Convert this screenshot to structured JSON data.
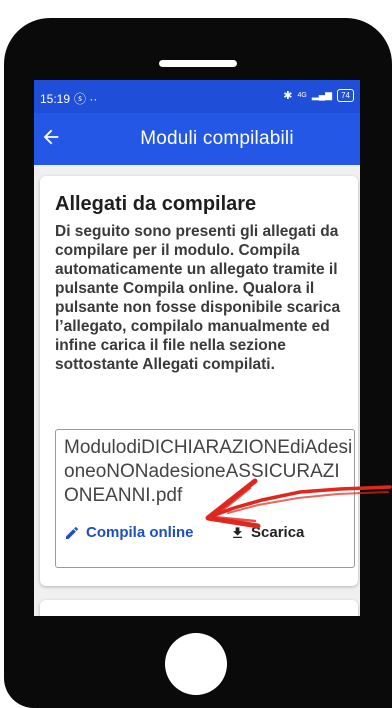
{
  "status_bar": {
    "time": "15:19",
    "notifications": "ⓢ ··",
    "bluetooth": "✱",
    "network": "4G",
    "signal": "▂▄▆",
    "battery": "74"
  },
  "app_bar": {
    "title": "Moduli compilabili",
    "back_icon": "arrow-left-icon"
  },
  "card": {
    "title": "Allegati da compilare",
    "description": "Di seguito sono presenti gli allegati da compilare per il modulo. Compila automaticamente un allegato tramite il pulsante Compila online. Qualora il pulsante non fosse disponibile scarica l’allegato, compilalo manualmente ed infine carica il file nella sezione sottostante Allegati compilati.",
    "file": {
      "name": "ModulodiDICHIARAZIONEdiAdesioneoNONadesioneASSICURAZIONEANNI.pdf",
      "compila_label": "Compila online",
      "compila_icon": "pencil-icon",
      "scarica_label": "Scarica",
      "scarica_icon": "download-icon"
    }
  },
  "colors": {
    "app_bar": "#2457e6",
    "status_bar": "#1f4ed8",
    "link": "#1f4fbf",
    "annotation_arrow": "#e0271e"
  }
}
